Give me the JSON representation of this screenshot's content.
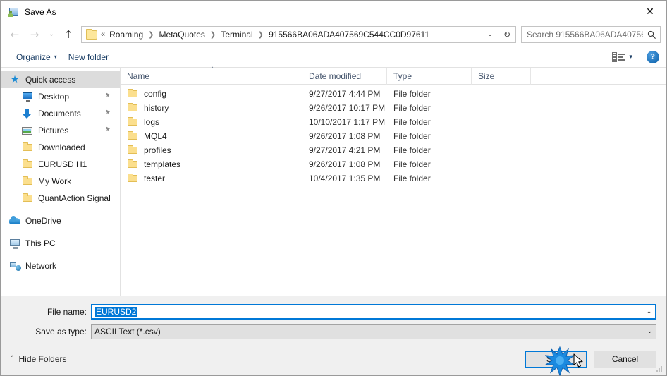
{
  "window": {
    "title": "Save As",
    "icon": "save-as-icon",
    "close_label": "✕"
  },
  "nav": {
    "back": "←",
    "forward": "→",
    "recent": "⌄",
    "up": "↑",
    "back_name": "back-button",
    "forward_name": "forward-button",
    "up_name": "up-button"
  },
  "address": {
    "leading": "«",
    "crumbs": [
      "Roaming",
      "MetaQuotes",
      "Terminal",
      "915566BA06ADA407569C544CC0D97611"
    ],
    "separator": "❯",
    "dropdown": "⌄",
    "refresh": "↻"
  },
  "search": {
    "placeholder": "Search 915566BA06ADA40756...",
    "icon": "🔍"
  },
  "toolbar": {
    "organize": "Organize",
    "organize_caret": "▾",
    "new_folder": "New folder",
    "view_caret": "▾",
    "help": "?"
  },
  "sidebar": {
    "items": [
      {
        "label": "Quick access",
        "icon": "star-icon",
        "selected": true,
        "indent": false,
        "pinned": false
      },
      {
        "label": "Desktop",
        "icon": "desktop-icon",
        "selected": false,
        "indent": true,
        "pinned": true
      },
      {
        "label": "Documents",
        "icon": "documents-icon",
        "selected": false,
        "indent": true,
        "pinned": true
      },
      {
        "label": "Pictures",
        "icon": "pictures-icon",
        "selected": false,
        "indent": true,
        "pinned": true
      },
      {
        "label": "Downloaded",
        "icon": "folder-icon",
        "selected": false,
        "indent": true,
        "pinned": false
      },
      {
        "label": "EURUSD H1",
        "icon": "folder-icon",
        "selected": false,
        "indent": true,
        "pinned": false
      },
      {
        "label": "My Work",
        "icon": "folder-icon",
        "selected": false,
        "indent": true,
        "pinned": false
      },
      {
        "label": "QuantAction Signal",
        "icon": "folder-icon",
        "selected": false,
        "indent": true,
        "pinned": false
      },
      {
        "label": "OneDrive",
        "icon": "onedrive-icon",
        "selected": false,
        "indent": false,
        "pinned": false,
        "gap_before": true
      },
      {
        "label": "This PC",
        "icon": "this-pc-icon",
        "selected": false,
        "indent": false,
        "pinned": false,
        "gap_before": true
      },
      {
        "label": "Network",
        "icon": "network-icon",
        "selected": false,
        "indent": false,
        "pinned": false,
        "gap_before": true
      }
    ],
    "pin_glyph": "📌"
  },
  "filelist": {
    "columns": [
      "Name",
      "Date modified",
      "Type",
      "Size"
    ],
    "sort_caret": "˄",
    "rows": [
      {
        "name": "config",
        "date": "9/27/2017 4:44 PM",
        "type": "File folder",
        "size": ""
      },
      {
        "name": "history",
        "date": "9/26/2017 10:17 PM",
        "type": "File folder",
        "size": ""
      },
      {
        "name": "logs",
        "date": "10/10/2017 1:17 PM",
        "type": "File folder",
        "size": ""
      },
      {
        "name": "MQL4",
        "date": "9/26/2017 1:08 PM",
        "type": "File folder",
        "size": ""
      },
      {
        "name": "profiles",
        "date": "9/27/2017 4:21 PM",
        "type": "File folder",
        "size": ""
      },
      {
        "name": "templates",
        "date": "9/26/2017 1:08 PM",
        "type": "File folder",
        "size": ""
      },
      {
        "name": "tester",
        "date": "10/4/2017 1:35 PM",
        "type": "File folder",
        "size": ""
      }
    ]
  },
  "form": {
    "file_name_label": "File name:",
    "file_name_value": "EURUSD2",
    "save_type_label": "Save as type:",
    "save_type_value": "ASCII Text (*.csv)",
    "dropdown_glyph": "⌄"
  },
  "actions": {
    "hide_folders": "Hide Folders",
    "hide_folders_caret": "˄",
    "save": "Save",
    "cancel": "Cancel"
  },
  "colors": {
    "accent": "#0078d7",
    "selection": "#0078d7",
    "sidebar_selected": "#dcdcdc",
    "footer_bg": "#f0f0f0",
    "folder": "#fbdf8e"
  }
}
